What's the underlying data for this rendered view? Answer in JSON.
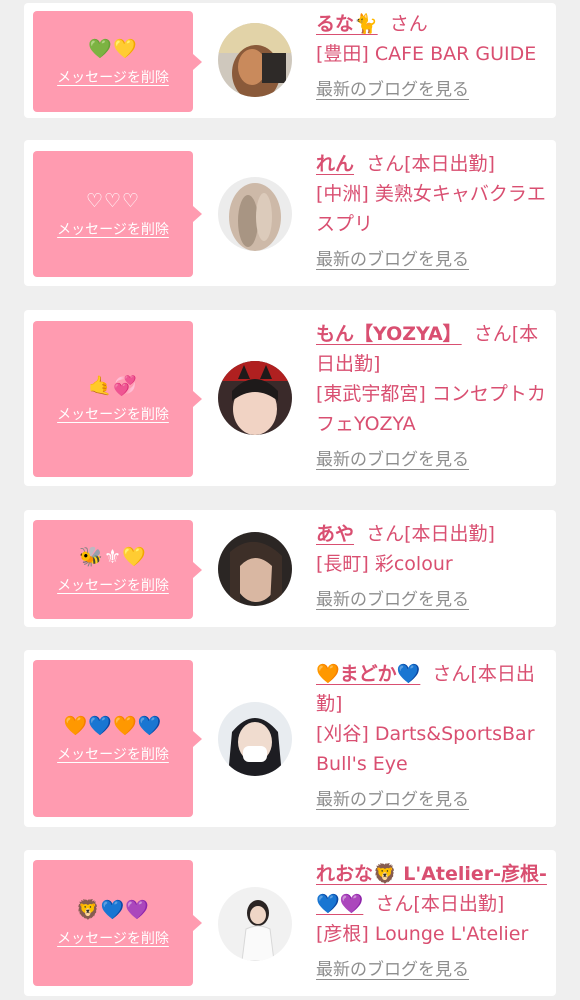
{
  "common": {
    "delete_label": "メッセージを削除",
    "blog_label": "最新のブログを見る",
    "accent_pink": "#ff9bb0",
    "text_pink": "#d94f71"
  },
  "cards": [
    {
      "emoji": "💚💛",
      "name": "るな🐈",
      "suffix": "さん",
      "shop": "[豊田] CAFE BAR GUIDE",
      "avatar_icon": "avatar-photo-brown-hair"
    },
    {
      "emoji": "♡♡♡",
      "name": "れん",
      "suffix": "さん[本日出勤]",
      "shop": "[中洲] 美熟女キャバクラエスプリ",
      "avatar_icon": "avatar-photo-blonde-hair"
    },
    {
      "emoji": "🤙💞",
      "name": "もん【YOZYA】",
      "suffix": "さん[本日出勤]",
      "shop": "[東武宇都宮] コンセプトカフェYOZYA",
      "avatar_icon": "avatar-photo-cat-ears"
    },
    {
      "emoji": "🐝⚜💛",
      "name": "あや",
      "suffix": "さん[本日出勤]",
      "shop": "[長町] 彩colour",
      "avatar_icon": "avatar-photo-dark-hair"
    },
    {
      "emoji": "🧡💙🧡💙",
      "name": "🧡まどか💙",
      "suffix": "さん[本日出勤]",
      "shop": "[刈谷] Darts&SportsBar Bull's Eye",
      "avatar_icon": "avatar-photo-mask"
    },
    {
      "emoji": "🦁💙💜",
      "name": "れおな🦁 L'Atelier-彦根-💙💜",
      "suffix": "さん[本日出勤]",
      "shop": "[彦根] Lounge L'Atelier",
      "avatar_icon": "avatar-photo-white-outfit"
    }
  ]
}
